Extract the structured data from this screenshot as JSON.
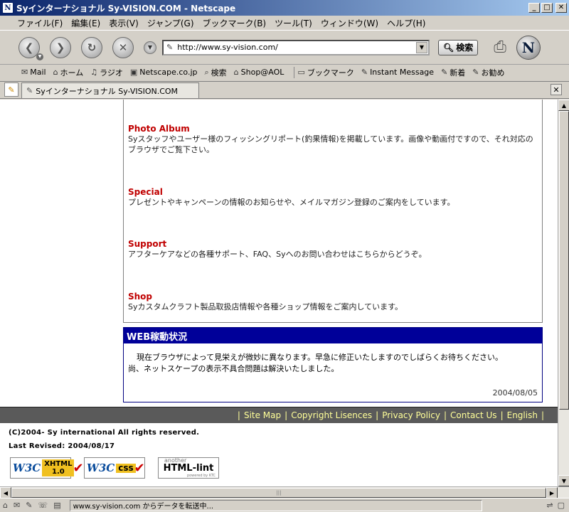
{
  "window": {
    "title": "Syインターナショナル Sy-VISION.COM - Netscape",
    "app_icon": "netscape-icon"
  },
  "menubar": {
    "items": [
      "ファイル(F)",
      "編集(E)",
      "表示(V)",
      "ジャンプ(G)",
      "ブックマーク(B)",
      "ツール(T)",
      "ウィンドウ(W)",
      "ヘルプ(H)"
    ]
  },
  "navbar": {
    "url": "http://www.sy-vision.com/",
    "search_label": "検索"
  },
  "personal_toolbar": {
    "items": [
      "Mail",
      "ホーム",
      "ラジオ",
      "Netscape.co.jp",
      "検索",
      "Shop@AOL",
      "ブックマーク",
      "Instant Message",
      "新着",
      "お勧め"
    ]
  },
  "tab": {
    "label": "Syインターナショナル Sy-VISION.COM"
  },
  "content": {
    "sections": [
      {
        "title": "Photo Album",
        "desc": "Syスタッフやユーザー様のフィッシングリポート(釣果情報)を掲載しています。画像や動画付ですので、それ対応のブラウザでご覧下さい。"
      },
      {
        "title": "Special",
        "desc": "プレゼントやキャンペーンの情報のお知らせや、メイルマガジン登録のご案内をしています。"
      },
      {
        "title": "Support",
        "desc": "アフターケアなどの各種サポート、FAQ、Syへのお問い合わせはこちらからどうぞ。"
      },
      {
        "title": "Shop",
        "desc": "Syカスタムクラフト製品取扱店情報や各種ショップ情報をご案内しています。"
      }
    ],
    "web_status": {
      "header": "WEB稼動状況",
      "line1": "現在ブラウザによって見栄えが微妙に異なります。早急に修正いたしますのでしばらくお待ちください。",
      "line2": "尚、ネットスケープの表示不具合問題は解決いたしました。",
      "date": "2004/08/05"
    }
  },
  "footer": {
    "links": [
      "Site Map",
      "Copyright Lisences",
      "Privacy Policy",
      "Contact Us",
      "English"
    ],
    "copyright": "(C)2004- Sy international All rights reserved.",
    "last_revised": "Last Revised: 2004/08/17",
    "badges": {
      "xhtml": {
        "w3c": "W3C",
        "line1": "XHTML",
        "line2": "1.0"
      },
      "css": {
        "w3c": "W3C",
        "label": "css"
      },
      "lint": {
        "another": "another",
        "label": "HTML-lint",
        "powered": "powered by KTC"
      }
    }
  },
  "statusbar": {
    "text": "www.sy-vision.com からデータを転送中..."
  }
}
